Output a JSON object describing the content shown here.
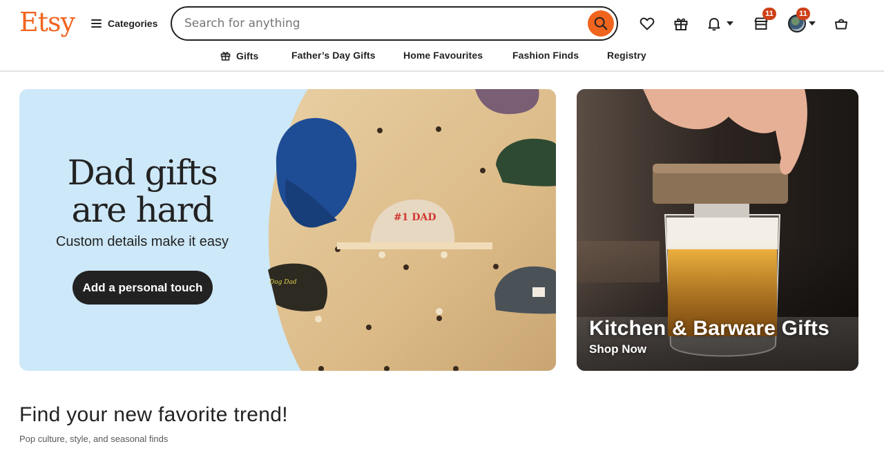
{
  "brand": {
    "logo": "Etsy",
    "accent": "#f1641e"
  },
  "header": {
    "categories_label": "Categories",
    "search_placeholder": "Search for anything",
    "cart_badge": "11",
    "account_badge": "11"
  },
  "subnav": {
    "items": [
      {
        "label": "Gifts",
        "icon": "gift-icon"
      },
      {
        "label": "Father’s Day Gifts"
      },
      {
        "label": "Home Favourites"
      },
      {
        "label": "Fashion Finds"
      },
      {
        "label": "Registry"
      }
    ]
  },
  "hero": {
    "title_line1": "Dad gifts",
    "title_line2": "are hard",
    "subtitle": "Custom details make it easy",
    "cta": "Add a personal touch",
    "cap_label_1": "#1 DAD",
    "cap_label_2": "Dog Dad",
    "background": "#cde8f8"
  },
  "promo": {
    "title": "Kitchen & Barware Gifts",
    "subtitle": "Shop Now"
  },
  "trend": {
    "title": "Find your new favorite trend!",
    "subtitle": "Pop culture, style, and seasonal finds"
  }
}
